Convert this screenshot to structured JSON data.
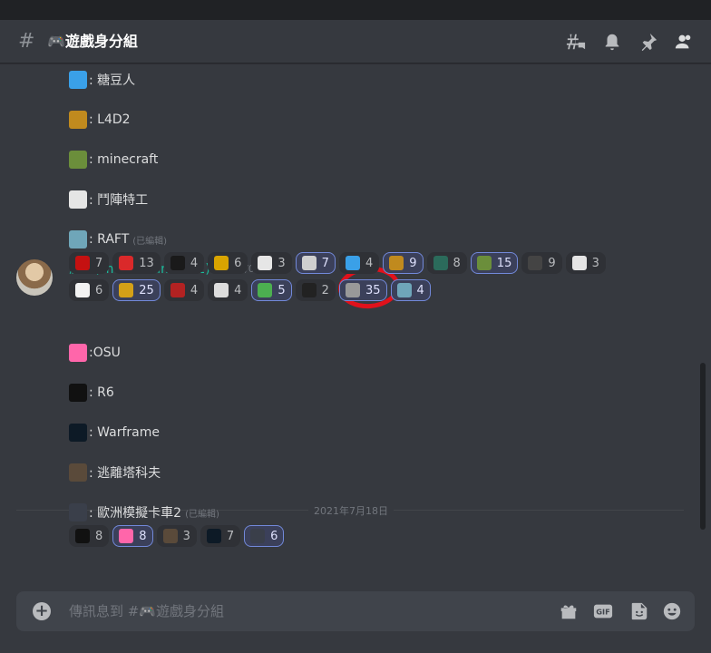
{
  "channel": {
    "title": "🎮遊戲身分組"
  },
  "messages_top": [
    {
      "name": "fall-guys-line",
      "text": ": 糖豆人",
      "edited": "",
      "color": "#3aa0e8"
    },
    {
      "name": "l4d2-line",
      "text": ": L4D2",
      "edited": "",
      "color": "#c08a1e"
    },
    {
      "name": "minecraft-line",
      "text": ": minecraft",
      "edited": "",
      "color": "#6b8e3b"
    },
    {
      "name": "overwatch-line",
      "text": ": 鬥陣特工",
      "edited": "",
      "color": "#e5e5e5"
    },
    {
      "name": "raft-line",
      "text": ": RAFT",
      "edited": "(已編輯)",
      "color": "#6fa6b9"
    }
  ],
  "reactions_row1": [
    {
      "icon": "among-us-icon",
      "count": "7",
      "on": false,
      "color": "#c51111"
    },
    {
      "icon": "apex-icon",
      "count": "13",
      "on": false,
      "color": "#da292a"
    },
    {
      "icon": "game-logo-icon",
      "count": "4",
      "on": false,
      "color": "#1a1a1a"
    },
    {
      "icon": "game-logo-icon",
      "count": "6",
      "on": false,
      "color": "#d9a400"
    },
    {
      "icon": "game-logo-icon",
      "count": "3",
      "on": false,
      "color": "#e6e6e6"
    },
    {
      "icon": "destiny-icon",
      "count": "7",
      "on": true,
      "color": "#cfcfcf"
    },
    {
      "icon": "fall-guys-icon",
      "count": "4",
      "on": false,
      "color": "#3aa0e8"
    },
    {
      "icon": "l4d2-icon",
      "count": "9",
      "on": true,
      "color": "#c08a1e"
    },
    {
      "icon": "game-logo-icon",
      "count": "8",
      "on": false,
      "color": "#2b6b5b"
    },
    {
      "icon": "minecraft-icon",
      "count": "15",
      "on": true,
      "color": "#6b8e3b"
    },
    {
      "icon": "game-logo-icon",
      "count": "9",
      "on": false,
      "color": "#444444"
    },
    {
      "icon": "overwatch-icon",
      "count": "3",
      "on": false,
      "color": "#e5e5e5"
    }
  ],
  "reactions_row2": [
    {
      "icon": "pubg-icon",
      "count": "6",
      "on": false,
      "color": "#f2f2f2"
    },
    {
      "icon": "game-logo-icon",
      "count": "25",
      "on": true,
      "color": "#d4a017"
    },
    {
      "icon": "game-logo-icon",
      "count": "4",
      "on": false,
      "color": "#b22222"
    },
    {
      "icon": "game-logo-icon",
      "count": "4",
      "on": false,
      "color": "#dddddd"
    },
    {
      "icon": "sims-icon",
      "count": "5",
      "on": true,
      "color": "#4caf50"
    },
    {
      "icon": "game-logo-icon",
      "count": "2",
      "on": false,
      "color": "#222222"
    },
    {
      "icon": "game-logo-icon",
      "count": "35",
      "on": true,
      "color": "#999999"
    },
    {
      "icon": "raft-icon",
      "count": "4",
      "on": true,
      "color": "#6fa6b9"
    }
  ],
  "author": {
    "name": "澍哥(smilecream0702)",
    "timestamp": "2021/07/17"
  },
  "messages_bottom": [
    {
      "name": "osu-line",
      "text": ":OSU",
      "edited": "",
      "color": "#ff66aa"
    },
    {
      "name": "r6-line",
      "text": ": R6",
      "edited": "",
      "color": "#111111"
    },
    {
      "name": "warframe-line",
      "text": ": Warframe",
      "edited": "",
      "color": "#0d1a26"
    },
    {
      "name": "tarkov-line",
      "text": ": 逃離塔科夫",
      "edited": "",
      "color": "#5a4a3a"
    },
    {
      "name": "ets2-line",
      "text": ": 歐洲模擬卡車2",
      "edited": "(已編輯)",
      "color": "#3a3f4a"
    }
  ],
  "reactions_row3": [
    {
      "icon": "r6-icon",
      "count": "8",
      "on": false,
      "color": "#111111"
    },
    {
      "icon": "osu-icon",
      "count": "8",
      "on": true,
      "color": "#ff66aa"
    },
    {
      "icon": "tarkov-icon",
      "count": "3",
      "on": false,
      "color": "#5a4a3a"
    },
    {
      "icon": "warframe-icon",
      "count": "7",
      "on": false,
      "color": "#0d1a26"
    },
    {
      "icon": "ets2-icon",
      "count": "6",
      "on": true,
      "color": "#3a3f4a"
    }
  ],
  "date_divider": "2021年7月18日",
  "composer": {
    "placeholder": "傳訊息到 #🎮遊戲身分組"
  }
}
